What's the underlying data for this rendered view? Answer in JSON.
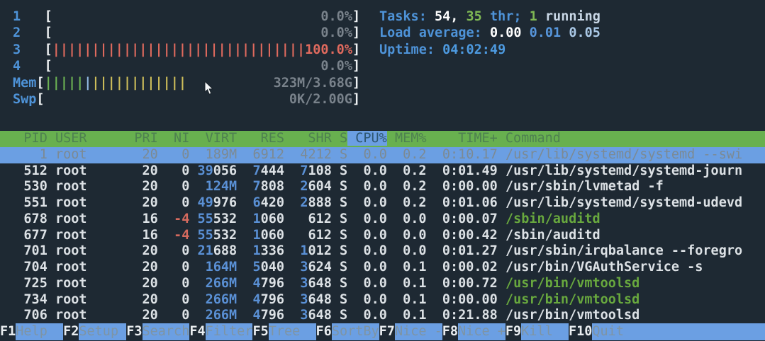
{
  "colors": {
    "background": "#1e2933",
    "header_green": "#68b04f",
    "selection_blue": "#6b9fe3",
    "label_blue": "#4e93d8",
    "number_blue": "#5a90d5",
    "cpu_bar_red": "#e06a5e",
    "mem_bar_green": "#6cb253",
    "mem_bar_cache_yellow": "#cdbd5a",
    "thread_green": "#68a83e",
    "text_white": "#dce1e5"
  },
  "meters": {
    "cpu": [
      {
        "label": "1",
        "value": "0.0%",
        "bars": 0
      },
      {
        "label": "2",
        "value": "0.0%",
        "bars": 0
      },
      {
        "label": "3",
        "value": "100.0%",
        "bars": 32
      },
      {
        "label": "4",
        "value": "0.0%",
        "bars": 0
      }
    ],
    "mem": {
      "label": "Mem",
      "value": "323M/3.68G",
      "bars_green": 5,
      "bars_blue": 1,
      "bars_yellow": 12
    },
    "swp": {
      "label": "Swp",
      "value": "0K/2.00G"
    }
  },
  "summary": {
    "tasks": {
      "label": "Tasks: ",
      "count": "54, ",
      "threads": "35",
      "thr_label": " thr; ",
      "running": "1",
      "running_label": " running"
    },
    "load": {
      "label": "Load average: ",
      "one": "0.00 ",
      "five": "0.01 ",
      "fifteen": "0.05"
    },
    "uptime": {
      "label": "Uptime: ",
      "value": "04:02:49"
    }
  },
  "table": {
    "columns": {
      "pid": "PID",
      "user": "USER",
      "pri": "PRI",
      "ni": "NI",
      "virt": "VIRT",
      "res": "RES",
      "shr": "SHR",
      "s": "S",
      "cpu": "CPU%",
      "mem": "MEM%",
      "time": "TIME+",
      "command": "Command"
    },
    "sort_column": "CPU%",
    "rows": [
      {
        "pid": "1",
        "user": "root",
        "pri": "20",
        "ni": "0",
        "virt": "189M",
        "virt_hi": 0,
        "res": "6912",
        "res_hi": 0,
        "shr": "4212",
        "shr_hi": 0,
        "s": "S",
        "cpu": "0.0",
        "mem": "0.2",
        "time": "0:10.17",
        "cmd": "/usr/lib/systemd/systemd --swi",
        "cmd_green": false,
        "selected": true
      },
      {
        "pid": "512",
        "user": "root",
        "pri": "20",
        "ni": "0",
        "virt": "39056",
        "virt_hi": 2,
        "res": "7444",
        "res_hi": 1,
        "shr": "7108",
        "shr_hi": 1,
        "s": "S",
        "cpu": "0.0",
        "mem": "0.2",
        "time": "0:01.49",
        "cmd": "/usr/lib/systemd/systemd-journ",
        "cmd_green": false,
        "selected": false
      },
      {
        "pid": "530",
        "user": "root",
        "pri": "20",
        "ni": "0",
        "virt": "124M",
        "virt_hi": 4,
        "res": "7808",
        "res_hi": 1,
        "shr": "2604",
        "shr_hi": 1,
        "s": "S",
        "cpu": "0.0",
        "mem": "0.2",
        "time": "0:00.00",
        "cmd": "/usr/sbin/lvmetad -f",
        "cmd_green": false,
        "selected": false
      },
      {
        "pid": "551",
        "user": "root",
        "pri": "20",
        "ni": "0",
        "virt": "49976",
        "virt_hi": 2,
        "res": "6420",
        "res_hi": 1,
        "shr": "2888",
        "shr_hi": 1,
        "s": "S",
        "cpu": "0.0",
        "mem": "0.2",
        "time": "0:01.06",
        "cmd": "/usr/lib/systemd/systemd-udevd",
        "cmd_green": false,
        "selected": false
      },
      {
        "pid": "678",
        "user": "root",
        "pri": "16",
        "ni": "-4",
        "virt": "55532",
        "virt_hi": 2,
        "res": "1060",
        "res_hi": 1,
        "shr": "612",
        "shr_hi": 0,
        "s": "S",
        "cpu": "0.0",
        "mem": "0.0",
        "time": "0:00.07",
        "cmd": "/sbin/auditd",
        "cmd_green": true,
        "selected": false
      },
      {
        "pid": "677",
        "user": "root",
        "pri": "16",
        "ni": "-4",
        "virt": "55532",
        "virt_hi": 2,
        "res": "1060",
        "res_hi": 1,
        "shr": "612",
        "shr_hi": 0,
        "s": "S",
        "cpu": "0.0",
        "mem": "0.0",
        "time": "0:00.42",
        "cmd": "/sbin/auditd",
        "cmd_green": false,
        "selected": false
      },
      {
        "pid": "701",
        "user": "root",
        "pri": "20",
        "ni": "0",
        "virt": "21688",
        "virt_hi": 2,
        "res": "1336",
        "res_hi": 1,
        "shr": "1012",
        "shr_hi": 1,
        "s": "S",
        "cpu": "0.0",
        "mem": "0.0",
        "time": "0:01.27",
        "cmd": "/usr/sbin/irqbalance --foregro",
        "cmd_green": false,
        "selected": false
      },
      {
        "pid": "704",
        "user": "root",
        "pri": "20",
        "ni": "0",
        "virt": "164M",
        "virt_hi": 4,
        "res": "5040",
        "res_hi": 1,
        "shr": "3624",
        "shr_hi": 1,
        "s": "S",
        "cpu": "0.0",
        "mem": "0.1",
        "time": "0:00.02",
        "cmd": "/usr/bin/VGAuthService -s",
        "cmd_green": false,
        "selected": false
      },
      {
        "pid": "725",
        "user": "root",
        "pri": "20",
        "ni": "0",
        "virt": "266M",
        "virt_hi": 4,
        "res": "4796",
        "res_hi": 1,
        "shr": "3648",
        "shr_hi": 1,
        "s": "S",
        "cpu": "0.0",
        "mem": "0.1",
        "time": "0:00.72",
        "cmd": "/usr/bin/vmtoolsd",
        "cmd_green": true,
        "selected": false
      },
      {
        "pid": "734",
        "user": "root",
        "pri": "20",
        "ni": "0",
        "virt": "266M",
        "virt_hi": 4,
        "res": "4796",
        "res_hi": 1,
        "shr": "3648",
        "shr_hi": 1,
        "s": "S",
        "cpu": "0.0",
        "mem": "0.1",
        "time": "0:00.00",
        "cmd": "/usr/bin/vmtoolsd",
        "cmd_green": true,
        "selected": false
      },
      {
        "pid": "706",
        "user": "root",
        "pri": "20",
        "ni": "0",
        "virt": "266M",
        "virt_hi": 4,
        "res": "4796",
        "res_hi": 1,
        "shr": "3648",
        "shr_hi": 1,
        "s": "S",
        "cpu": "0.0",
        "mem": "0.1",
        "time": "0:21.88",
        "cmd": "/usr/bin/vmtoolsd",
        "cmd_green": false,
        "selected": false
      }
    ]
  },
  "fnbar": [
    {
      "key": "F1",
      "label": "Help  "
    },
    {
      "key": "F2",
      "label": "Setup "
    },
    {
      "key": "F3",
      "label": "Search"
    },
    {
      "key": "F4",
      "label": "Filter"
    },
    {
      "key": "F5",
      "label": "Tree  "
    },
    {
      "key": "F6",
      "label": "SortBy"
    },
    {
      "key": "F7",
      "label": "Nice -"
    },
    {
      "key": "F8",
      "label": "Nice +"
    },
    {
      "key": "F9",
      "label": "Kill  "
    },
    {
      "key": "F10",
      "label": "Quit"
    }
  ]
}
